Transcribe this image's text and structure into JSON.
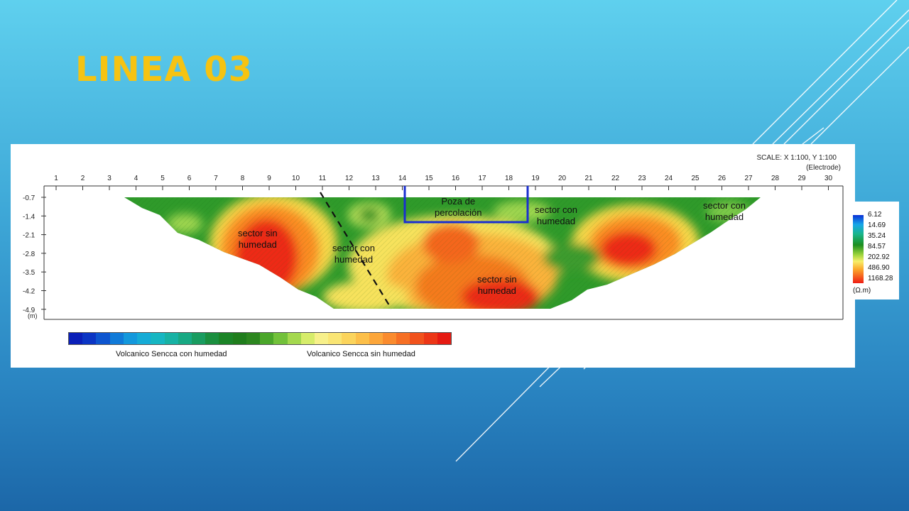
{
  "slide": {
    "title": "LINEA 03"
  },
  "figure": {
    "scale_text": "SCALE: X 1:100, Y 1:100",
    "electrode_text": "(Electrode)",
    "x_ticks": [
      "1",
      "2",
      "3",
      "4",
      "5",
      "6",
      "7",
      "8",
      "9",
      "10",
      "11",
      "12",
      "13",
      "14",
      "15",
      "16",
      "17",
      "18",
      "19",
      "20",
      "21",
      "22",
      "23",
      "24",
      "25",
      "26",
      "27",
      "28",
      "29",
      "30"
    ],
    "depth_ticks": [
      "-0.7",
      "-1.4",
      "-2.1",
      "-2.8",
      "-3.5",
      "-4.2",
      "-4.9"
    ],
    "depth_unit": "(m)",
    "annotations": [
      {
        "label": "sector sin humedad",
        "lines": [
          "sector sin",
          "humedad"
        ]
      },
      {
        "label": "sector con humedad",
        "lines": [
          "sector con",
          "humedad"
        ]
      },
      {
        "label": "Poza de percolación",
        "lines": [
          "Poza de",
          "percolación"
        ]
      },
      {
        "label": "sector con humedad",
        "lines": [
          "sector con",
          "humedad"
        ]
      },
      {
        "label": "sector con humedad",
        "lines": [
          "sector con",
          "humedad"
        ]
      },
      {
        "label": "sector sin humedad",
        "lines": [
          "sector sin",
          "humedad"
        ]
      }
    ],
    "legend": {
      "wet_label": "Volcanico Sencca con humedad",
      "dry_label": "Volcanico Sencca sin humedad"
    },
    "color_key": {
      "values": [
        "6.12",
        "14.69",
        "35.24",
        "84.57",
        "202.92",
        "486.90",
        "1168.28"
      ],
      "unit": "(Ω.m)"
    }
  },
  "colors": {
    "title": "#f5c312",
    "wet_green": "#1c8e1f",
    "dry_red": "#ef1d14",
    "pool_outline": "#1a2fd0"
  }
}
